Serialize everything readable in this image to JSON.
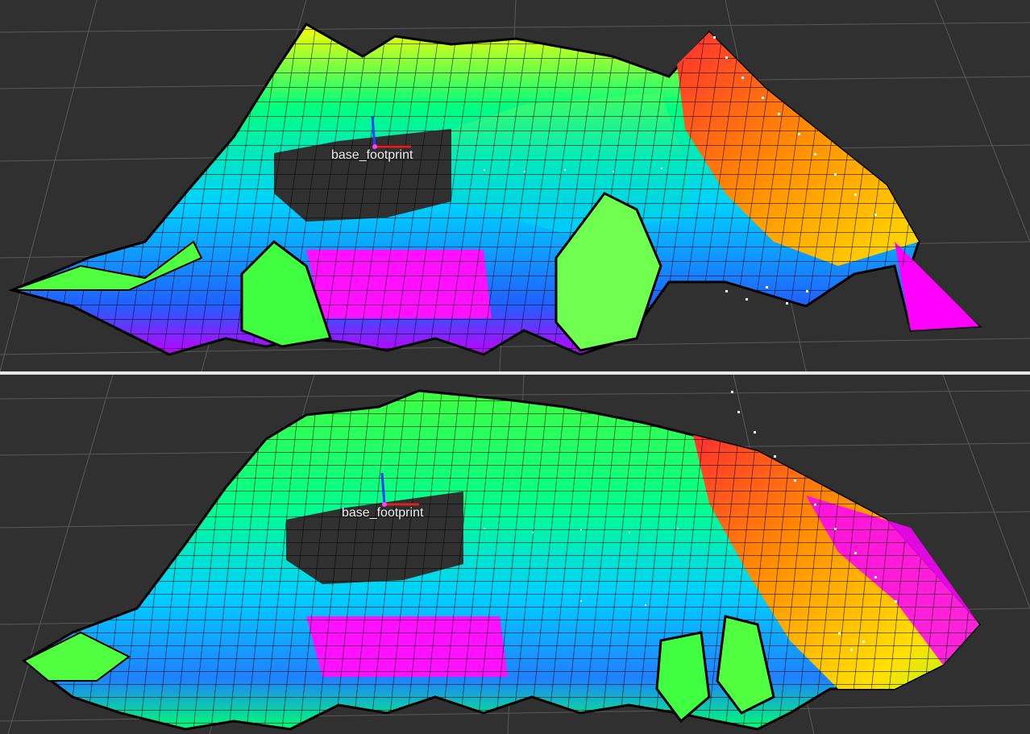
{
  "viewports": [
    {
      "id": "top",
      "frame_label": "base_footprint"
    },
    {
      "id": "bottom",
      "frame_label": "base_footprint"
    }
  ],
  "colors": {
    "background": "#303030",
    "grid": "#5a5a5a",
    "divider": "#e6e6e6",
    "frame_x_axis": "#e02020",
    "frame_z_axis": "#2040ff",
    "elevation_colormap": [
      "#ff00ff",
      "#00c8ff",
      "#00ff80",
      "#ffff00",
      "#ff8000",
      "#ff2020"
    ],
    "point_cloud": "#ffffff"
  },
  "icons": [
    "tf-frame-axes-icon"
  ]
}
